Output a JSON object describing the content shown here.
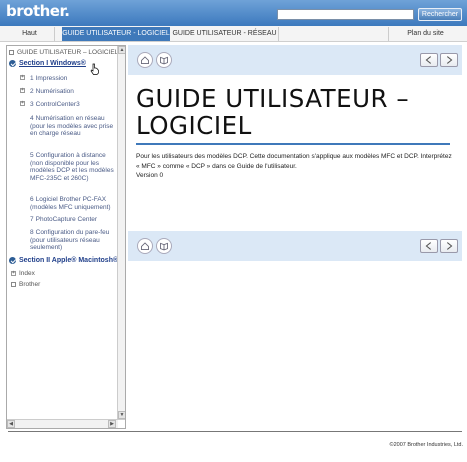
{
  "header": {
    "logo": "brother.",
    "search_placeholder": "",
    "search_button": "Rechercher"
  },
  "nav": {
    "tabs": [
      {
        "label": "Haut"
      },
      {
        "label": "GUIDE UTILISATEUR - LOGICIEL",
        "active": true
      },
      {
        "label": "GUIDE UTILISATEUR - RÉSEAU"
      },
      {
        "label": "Plan du site"
      }
    ]
  },
  "sidebar": {
    "root": "GUIDE UTILISATEUR – LOGICIEL",
    "section1": "Section I Windows®",
    "items": [
      {
        "num": "1",
        "label": "Impression"
      },
      {
        "num": "2",
        "label": "Numérisation"
      },
      {
        "num": "3",
        "label": "ControlCenter3"
      },
      {
        "num": "4",
        "label": "Numérisation en réseau (pour les modèles avec prise en charge réseau"
      },
      {
        "num": "5",
        "label": "Configuration à distance (non disponible pour les modèles DCP et les modèles MFC-235C et 260C)"
      },
      {
        "num": "6",
        "label": "Logiciel Brother PC-FAX (modèles MFC uniquement)"
      },
      {
        "num": "7",
        "label": "PhotoCapture Center"
      },
      {
        "num": "8",
        "label": "Configuration du pare-feu (pour utilisateurs réseau seulement)"
      }
    ],
    "section2": "Section II Apple® Macintosh®",
    "index": "Index",
    "brother": "Brother"
  },
  "main": {
    "title": "GUIDE UTILISATEUR – LOGICIEL",
    "description": "Pour les utilisateurs des modèles DCP. Cette documentation s'applique aux modèles MFC et DCP. Interprétez « MFC » comme « DCP » dans ce Guide de l'utilisateur.",
    "version": "Version 0"
  },
  "footer": {
    "copyright": "©2007 Brother Industries, Ltd."
  },
  "colors": {
    "header": "#3c79bd",
    "accent": "#3f79ba",
    "toolbar": "#dbe8f6"
  }
}
